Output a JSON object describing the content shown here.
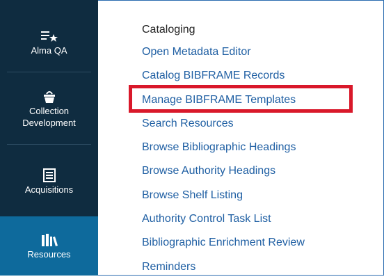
{
  "sidebar": {
    "items": [
      {
        "label": "Alma QA",
        "icon": "list-star-icon"
      },
      {
        "label_line1": "Collection",
        "label_line2": "Development",
        "icon": "basket-icon"
      },
      {
        "label": "Acquisitions",
        "icon": "ledger-icon"
      },
      {
        "label": "Resources",
        "icon": "books-icon",
        "active": true
      }
    ]
  },
  "menu": {
    "title": "Cataloging",
    "items": [
      "Open Metadata Editor",
      "Catalog BIBFRAME Records",
      "Manage BIBFRAME Templates",
      "Search Resources",
      "Browse Bibliographic Headings",
      "Browse Authority Headings",
      "Browse Shelf Listing",
      "Authority Control Task List",
      "Bibliographic Enrichment Review",
      "Reminders"
    ]
  },
  "colors": {
    "sidebar_bg": "#0f2c40",
    "active_bg": "#0e6a9c",
    "link": "#1f5fa3",
    "highlight": "#d9182a"
  }
}
